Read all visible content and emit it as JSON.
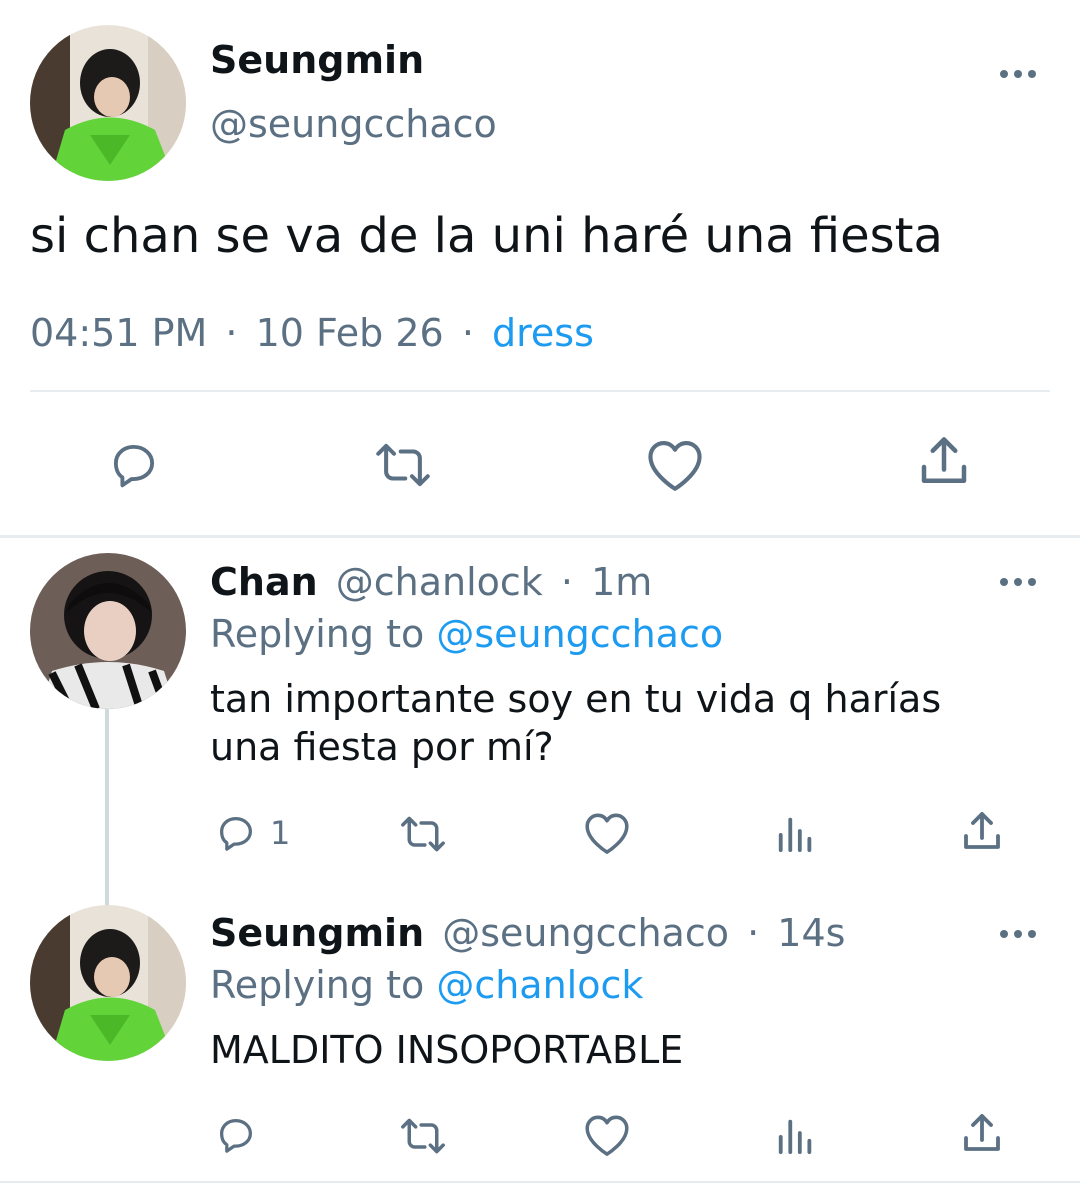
{
  "main_tweet": {
    "author_name": "Seungmin",
    "author_handle": "@seungcchaco",
    "text": "si chan se va de la uni haré una fiesta",
    "time": "04:51 PM",
    "sep1": "·",
    "date": "10 Feb 26",
    "sep2": "·",
    "source": "dress"
  },
  "replies": [
    {
      "author_name": "Chan",
      "author_handle": "@chanlock",
      "sep": "·",
      "age": "1m",
      "replying_prefix": "Replying to",
      "replying_to": "@seungcchaco",
      "text_line1": "tan importante soy en tu vida q harías",
      "text_line2": "una fiesta por mí?",
      "reply_count": "1"
    },
    {
      "author_name": "Seungmin",
      "author_handle": "@seungcchaco",
      "sep": "·",
      "age": "14s",
      "replying_prefix": "Replying to",
      "replying_to": "@chanlock",
      "text": "MALDITO INSOPORTABLE",
      "reply_count": ""
    }
  ],
  "icons": [
    "more-icon",
    "reply-icon",
    "retweet-icon",
    "like-icon",
    "share-icon",
    "analytics-icon"
  ],
  "colors": {
    "text": "#0f1419",
    "muted": "#5b7083",
    "link": "#1d9bf0",
    "divider": "#e6ecf0",
    "avatar_green": "#5fd236"
  }
}
